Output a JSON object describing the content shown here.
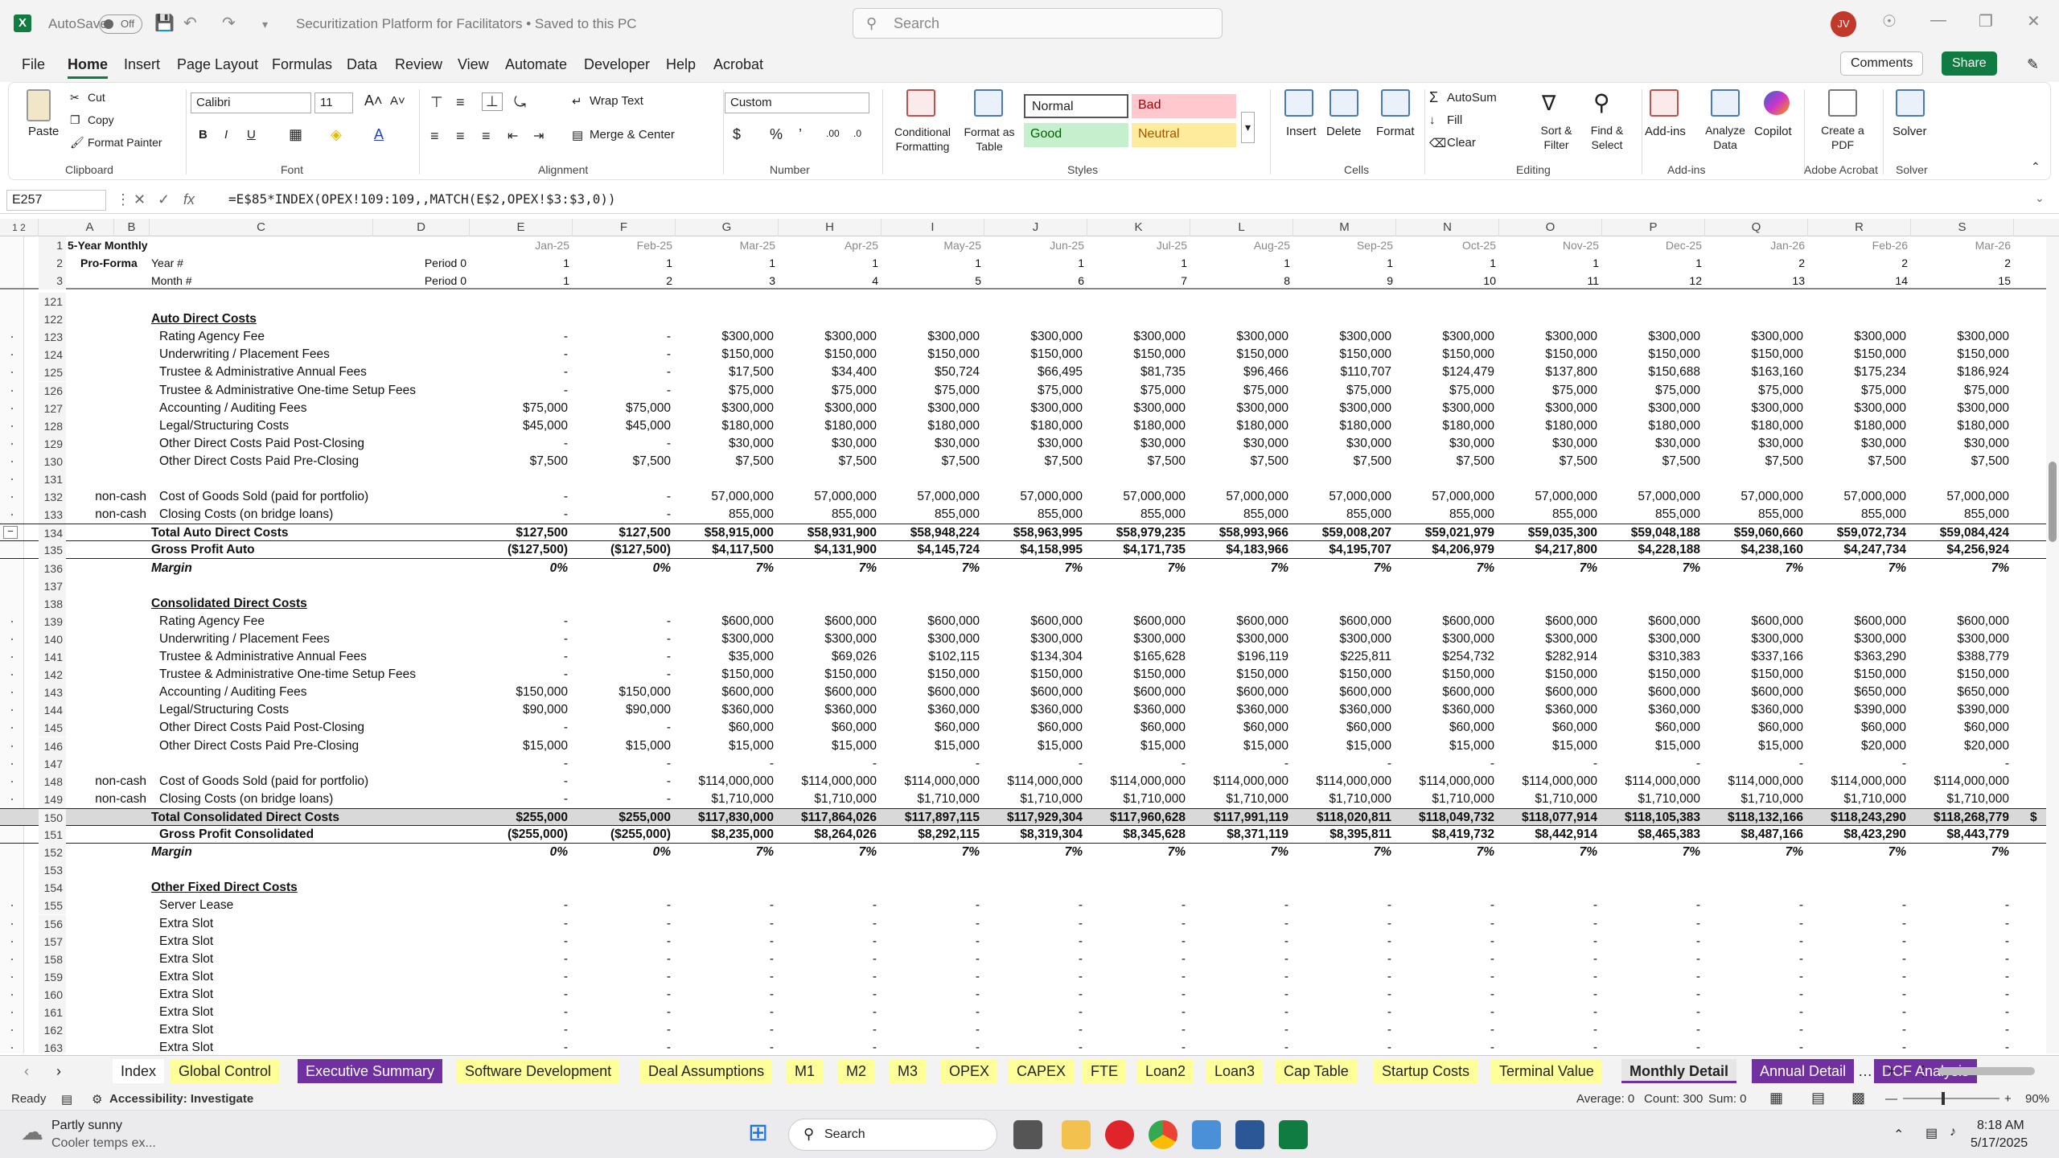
{
  "titlebar": {
    "autosave": "AutoSave",
    "toggle": "Off",
    "title": "Securitization Platform for Facilitators • Saved to this PC",
    "search": "Search",
    "avatar": "JV"
  },
  "menu": [
    "File",
    "Home",
    "Insert",
    "Page Layout",
    "Formulas",
    "Data",
    "Review",
    "View",
    "Automate",
    "Developer",
    "Help",
    "Acrobat"
  ],
  "menu_right": {
    "comments": "Comments",
    "share": "Share"
  },
  "ribbon": {
    "clipboard": {
      "paste": "Paste",
      "cut": "Cut",
      "copy": "Copy",
      "format_painter": "Format Painter",
      "label": "Clipboard"
    },
    "font": {
      "name": "Calibri",
      "size": "11",
      "label": "Font"
    },
    "alignment": {
      "wrap": "Wrap Text",
      "merge": "Merge & Center",
      "label": "Alignment"
    },
    "number": {
      "format": "Custom",
      "label": "Number"
    },
    "styles": {
      "conditional": "Conditional Formatting",
      "format_table": "Format as Table",
      "normal": "Normal",
      "bad": "Bad",
      "good": "Good",
      "neutral": "Neutral",
      "label": "Styles"
    },
    "cells": {
      "insert": "Insert",
      "delete": "Delete",
      "format": "Format",
      "label": "Cells"
    },
    "editing": {
      "autosum": "AutoSum",
      "fill": "Fill",
      "clear": "Clear",
      "sort": "Sort & Filter",
      "find": "Find & Select",
      "label": "Editing"
    },
    "addins": {
      "addins": "Add-ins",
      "analyze": "Analyze Data",
      "copilot": "Copilot",
      "label": "Add-ins"
    },
    "acrobat": {
      "create": "Create a PDF",
      "label": "Adobe Acrobat"
    },
    "solver": {
      "solver": "Solver",
      "label": "Solver"
    }
  },
  "formula_bar": {
    "cell_ref": "E257",
    "formula": "=E$85*INDEX(OPEX!109:109,,MATCH(E$2,OPEX!$3:$3,0))"
  },
  "columns": [
    "A",
    "B",
    "C",
    "D",
    "E",
    "F",
    "G",
    "H",
    "I",
    "J",
    "K",
    "L",
    "M",
    "N",
    "O",
    "P",
    "Q",
    "R",
    "S"
  ],
  "header_rows": {
    "r1": {
      "label": "5-Year Monthly",
      "dates": [
        "Jan-25",
        "Feb-25",
        "Mar-25",
        "Apr-25",
        "May-25",
        "Jun-25",
        "Jul-25",
        "Aug-25",
        "Sep-25",
        "Oct-25",
        "Nov-25",
        "Dec-25",
        "Jan-26",
        "Feb-26",
        "Mar-26"
      ]
    },
    "r2": {
      "label": "Pro-Forma",
      "c": "Year #",
      "d": "Period 0",
      "vals": [
        "1",
        "1",
        "1",
        "1",
        "1",
        "1",
        "1",
        "1",
        "1",
        "1",
        "1",
        "1",
        "2",
        "2",
        "2"
      ]
    },
    "r3": {
      "c": "Month #",
      "d": "Period 0",
      "vals": [
        "1",
        "2",
        "3",
        "4",
        "5",
        "6",
        "7",
        "8",
        "9",
        "10",
        "11",
        "12",
        "13",
        "14",
        "15"
      ]
    }
  },
  "rows": [
    {
      "n": "121"
    },
    {
      "n": "122",
      "hdr": "Auto Direct Costs"
    },
    {
      "n": "123",
      "c": "Rating Agency Fee",
      "v": [
        "-",
        "-",
        "$300,000",
        "$300,000",
        "$300,000",
        "$300,000",
        "$300,000",
        "$300,000",
        "$300,000",
        "$300,000",
        "$300,000",
        "$300,000",
        "$300,000",
        "$300,000",
        "$300,000"
      ]
    },
    {
      "n": "124",
      "c": "Underwriting / Placement Fees",
      "v": [
        "-",
        "-",
        "$150,000",
        "$150,000",
        "$150,000",
        "$150,000",
        "$150,000",
        "$150,000",
        "$150,000",
        "$150,000",
        "$150,000",
        "$150,000",
        "$150,000",
        "$150,000",
        "$150,000"
      ]
    },
    {
      "n": "125",
      "c": "Trustee & Administrative Annual Fees",
      "v": [
        "-",
        "-",
        "$17,500",
        "$34,400",
        "$50,724",
        "$66,495",
        "$81,735",
        "$96,466",
        "$110,707",
        "$124,479",
        "$137,800",
        "$150,688",
        "$163,160",
        "$175,234",
        "$186,924"
      ]
    },
    {
      "n": "126",
      "c": "Trustee & Administrative One-time Setup Fees",
      "v": [
        "-",
        "-",
        "$75,000",
        "$75,000",
        "$75,000",
        "$75,000",
        "$75,000",
        "$75,000",
        "$75,000",
        "$75,000",
        "$75,000",
        "$75,000",
        "$75,000",
        "$75,000",
        "$75,000"
      ]
    },
    {
      "n": "127",
      "c": "Accounting / Auditing Fees",
      "v": [
        "$75,000",
        "$75,000",
        "$300,000",
        "$300,000",
        "$300,000",
        "$300,000",
        "$300,000",
        "$300,000",
        "$300,000",
        "$300,000",
        "$300,000",
        "$300,000",
        "$300,000",
        "$300,000",
        "$300,000"
      ]
    },
    {
      "n": "128",
      "c": "Legal/Structuring Costs",
      "v": [
        "$45,000",
        "$45,000",
        "$180,000",
        "$180,000",
        "$180,000",
        "$180,000",
        "$180,000",
        "$180,000",
        "$180,000",
        "$180,000",
        "$180,000",
        "$180,000",
        "$180,000",
        "$180,000",
        "$180,000"
      ]
    },
    {
      "n": "129",
      "c": "Other Direct Costs Paid Post-Closing",
      "v": [
        "-",
        "-",
        "$30,000",
        "$30,000",
        "$30,000",
        "$30,000",
        "$30,000",
        "$30,000",
        "$30,000",
        "$30,000",
        "$30,000",
        "$30,000",
        "$30,000",
        "$30,000",
        "$30,000"
      ]
    },
    {
      "n": "130",
      "c": "Other Direct Costs Paid Pre-Closing",
      "v": [
        "$7,500",
        "$7,500",
        "$7,500",
        "$7,500",
        "$7,500",
        "$7,500",
        "$7,500",
        "$7,500",
        "$7,500",
        "$7,500",
        "$7,500",
        "$7,500",
        "$7,500",
        "$7,500",
        "$7,500"
      ]
    },
    {
      "n": "131"
    },
    {
      "n": "132",
      "nc": "non-cash",
      "c": "Cost of Goods Sold (paid for portfolio)",
      "v": [
        "-",
        "-",
        "57,000,000",
        "57,000,000",
        "57,000,000",
        "57,000,000",
        "57,000,000",
        "57,000,000",
        "57,000,000",
        "57,000,000",
        "57,000,000",
        "57,000,000",
        "57,000,000",
        "57,000,000",
        "57,000,000"
      ]
    },
    {
      "n": "133",
      "nc": "non-cash",
      "c": "Closing Costs (on bridge loans)",
      "v": [
        "-",
        "-",
        "855,000",
        "855,000",
        "855,000",
        "855,000",
        "855,000",
        "855,000",
        "855,000",
        "855,000",
        "855,000",
        "855,000",
        "855,000",
        "855,000",
        "855,000"
      ]
    },
    {
      "n": "134",
      "bold": true,
      "total": true,
      "cb": "Total Auto Direct Costs",
      "v": [
        "$127,500",
        "$127,500",
        "$58,915,000",
        "$58,931,900",
        "$58,948,224",
        "$58,963,995",
        "$58,979,235",
        "$58,993,966",
        "$59,008,207",
        "$59,021,979",
        "$59,035,300",
        "$59,048,188",
        "$59,060,660",
        "$59,072,734",
        "$59,084,424"
      ]
    },
    {
      "n": "135",
      "bold": true,
      "gp": true,
      "cb": "Gross Profit Auto",
      "v": [
        "($127,500)",
        "($127,500)",
        "$4,117,500",
        "$4,131,900",
        "$4,145,724",
        "$4,158,995",
        "$4,171,735",
        "$4,183,966",
        "$4,195,707",
        "$4,206,979",
        "$4,217,800",
        "$4,228,188",
        "$4,238,160",
        "$4,247,734",
        "$4,256,924"
      ]
    },
    {
      "n": "136",
      "ital": true,
      "ci": "Margin",
      "v": [
        "0%",
        "0%",
        "7%",
        "7%",
        "7%",
        "7%",
        "7%",
        "7%",
        "7%",
        "7%",
        "7%",
        "7%",
        "7%",
        "7%",
        "7%"
      ]
    },
    {
      "n": "137"
    },
    {
      "n": "138",
      "hdr": "Consolidated Direct Costs"
    },
    {
      "n": "139",
      "c": "Rating Agency Fee",
      "v": [
        "-",
        "-",
        "$600,000",
        "$600,000",
        "$600,000",
        "$600,000",
        "$600,000",
        "$600,000",
        "$600,000",
        "$600,000",
        "$600,000",
        "$600,000",
        "$600,000",
        "$600,000",
        "$600,000"
      ]
    },
    {
      "n": "140",
      "c": "Underwriting / Placement Fees",
      "v": [
        "-",
        "-",
        "$300,000",
        "$300,000",
        "$300,000",
        "$300,000",
        "$300,000",
        "$300,000",
        "$300,000",
        "$300,000",
        "$300,000",
        "$300,000",
        "$300,000",
        "$300,000",
        "$300,000"
      ]
    },
    {
      "n": "141",
      "c": "Trustee & Administrative Annual Fees",
      "v": [
        "-",
        "-",
        "$35,000",
        "$69,026",
        "$102,115",
        "$134,304",
        "$165,628",
        "$196,119",
        "$225,811",
        "$254,732",
        "$282,914",
        "$310,383",
        "$337,166",
        "$363,290",
        "$388,779"
      ]
    },
    {
      "n": "142",
      "c": "Trustee & Administrative One-time Setup Fees",
      "v": [
        "-",
        "-",
        "$150,000",
        "$150,000",
        "$150,000",
        "$150,000",
        "$150,000",
        "$150,000",
        "$150,000",
        "$150,000",
        "$150,000",
        "$150,000",
        "$150,000",
        "$150,000",
        "$150,000"
      ]
    },
    {
      "n": "143",
      "c": "Accounting / Auditing Fees",
      "v": [
        "$150,000",
        "$150,000",
        "$600,000",
        "$600,000",
        "$600,000",
        "$600,000",
        "$600,000",
        "$600,000",
        "$600,000",
        "$600,000",
        "$600,000",
        "$600,000",
        "$600,000",
        "$650,000",
        "$650,000"
      ]
    },
    {
      "n": "144",
      "c": "Legal/Structuring Costs",
      "v": [
        "$90,000",
        "$90,000",
        "$360,000",
        "$360,000",
        "$360,000",
        "$360,000",
        "$360,000",
        "$360,000",
        "$360,000",
        "$360,000",
        "$360,000",
        "$360,000",
        "$360,000",
        "$390,000",
        "$390,000"
      ]
    },
    {
      "n": "145",
      "c": "Other Direct Costs Paid Post-Closing",
      "v": [
        "-",
        "-",
        "$60,000",
        "$60,000",
        "$60,000",
        "$60,000",
        "$60,000",
        "$60,000",
        "$60,000",
        "$60,000",
        "$60,000",
        "$60,000",
        "$60,000",
        "$60,000",
        "$60,000"
      ]
    },
    {
      "n": "146",
      "c": "Other Direct Costs Paid Pre-Closing",
      "v": [
        "$15,000",
        "$15,000",
        "$15,000",
        "$15,000",
        "$15,000",
        "$15,000",
        "$15,000",
        "$15,000",
        "$15,000",
        "$15,000",
        "$15,000",
        "$15,000",
        "$15,000",
        "$20,000",
        "$20,000"
      ]
    },
    {
      "n": "147",
      "v": [
        "-",
        "-",
        "-",
        "-",
        "-",
        "-",
        "-",
        "-",
        "-",
        "-",
        "-",
        "-",
        "-",
        "-",
        "-"
      ]
    },
    {
      "n": "148",
      "nc": "non-cash",
      "c": "Cost of Goods Sold (paid for portfolio)",
      "v": [
        "-",
        "-",
        "$114,000,000",
        "$114,000,000",
        "$114,000,000",
        "$114,000,000",
        "$114,000,000",
        "$114,000,000",
        "$114,000,000",
        "$114,000,000",
        "$114,000,000",
        "$114,000,000",
        "$114,000,000",
        "$114,000,000",
        "$114,000,000"
      ]
    },
    {
      "n": "149",
      "nc": "non-cash",
      "c": "Closing Costs (on bridge loans)",
      "v": [
        "-",
        "-",
        "$1,710,000",
        "$1,710,000",
        "$1,710,000",
        "$1,710,000",
        "$1,710,000",
        "$1,710,000",
        "$1,710,000",
        "$1,710,000",
        "$1,710,000",
        "$1,710,000",
        "$1,710,000",
        "$1,710,000",
        "$1,710,000"
      ]
    },
    {
      "n": "150",
      "bold": true,
      "total": true,
      "grey": true,
      "cb": "Total Consolidated Direct Costs",
      "v": [
        "$255,000",
        "$255,000",
        "$117,830,000",
        "$117,864,026",
        "$117,897,115",
        "$117,929,304",
        "$117,960,628",
        "$117,991,119",
        "$118,020,811",
        "$118,049,732",
        "$118,077,914",
        "$118,105,383",
        "$118,132,166",
        "$118,243,290",
        "$118,268,779"
      ],
      "extra": "$"
    },
    {
      "n": "151",
      "bold": true,
      "gp": true,
      "cbi": "Gross Profit Consolidated",
      "v": [
        "($255,000)",
        "($255,000)",
        "$8,235,000",
        "$8,264,026",
        "$8,292,115",
        "$8,319,304",
        "$8,345,628",
        "$8,371,119",
        "$8,395,811",
        "$8,419,732",
        "$8,442,914",
        "$8,465,383",
        "$8,487,166",
        "$8,423,290",
        "$8,443,779"
      ]
    },
    {
      "n": "152",
      "ital": true,
      "ci": "Margin",
      "v": [
        "0%",
        "0%",
        "7%",
        "7%",
        "7%",
        "7%",
        "7%",
        "7%",
        "7%",
        "7%",
        "7%",
        "7%",
        "7%",
        "7%",
        "7%"
      ]
    },
    {
      "n": "153"
    },
    {
      "n": "154",
      "hdr": "Other Fixed Direct Costs"
    },
    {
      "n": "155",
      "c": "Server Lease",
      "v": [
        "-",
        "-",
        "-",
        "-",
        "-",
        "-",
        "-",
        "-",
        "-",
        "-",
        "-",
        "-",
        "-",
        "-",
        "-"
      ]
    },
    {
      "n": "156",
      "c": "Extra Slot",
      "v": [
        "-",
        "-",
        "-",
        "-",
        "-",
        "-",
        "-",
        "-",
        "-",
        "-",
        "-",
        "-",
        "-",
        "-",
        "-"
      ]
    },
    {
      "n": "157",
      "c": "Extra Slot",
      "v": [
        "-",
        "-",
        "-",
        "-",
        "-",
        "-",
        "-",
        "-",
        "-",
        "-",
        "-",
        "-",
        "-",
        "-",
        "-"
      ]
    },
    {
      "n": "158",
      "c": "Extra Slot",
      "v": [
        "-",
        "-",
        "-",
        "-",
        "-",
        "-",
        "-",
        "-",
        "-",
        "-",
        "-",
        "-",
        "-",
        "-",
        "-"
      ]
    },
    {
      "n": "159",
      "c": "Extra Slot",
      "v": [
        "-",
        "-",
        "-",
        "-",
        "-",
        "-",
        "-",
        "-",
        "-",
        "-",
        "-",
        "-",
        "-",
        "-",
        "-"
      ]
    },
    {
      "n": "160",
      "c": "Extra Slot",
      "v": [
        "-",
        "-",
        "-",
        "-",
        "-",
        "-",
        "-",
        "-",
        "-",
        "-",
        "-",
        "-",
        "-",
        "-",
        "-"
      ]
    },
    {
      "n": "161",
      "c": "Extra Slot",
      "v": [
        "-",
        "-",
        "-",
        "-",
        "-",
        "-",
        "-",
        "-",
        "-",
        "-",
        "-",
        "-",
        "-",
        "-",
        "-"
      ]
    },
    {
      "n": "162",
      "c": "Extra Slot",
      "v": [
        "-",
        "-",
        "-",
        "-",
        "-",
        "-",
        "-",
        "-",
        "-",
        "-",
        "-",
        "-",
        "-",
        "-",
        "-"
      ]
    },
    {
      "n": "163",
      "c": "Extra Slot",
      "v": [
        "-",
        "-",
        "-",
        "-",
        "-",
        "-",
        "-",
        "-",
        "-",
        "-",
        "-",
        "-",
        "-",
        "-",
        "-"
      ]
    }
  ],
  "sheet_tabs": [
    {
      "label": "Index",
      "style": "idx"
    },
    {
      "label": "Global Control",
      "style": "y"
    },
    {
      "label": "Executive Summary",
      "style": "p"
    },
    {
      "label": "Software Development",
      "style": "y"
    },
    {
      "label": "Deal Assumptions",
      "style": "y"
    },
    {
      "label": "M1",
      "style": "y"
    },
    {
      "label": "M2",
      "style": "y"
    },
    {
      "label": "M3",
      "style": "y"
    },
    {
      "label": "OPEX",
      "style": "y"
    },
    {
      "label": "CAPEX",
      "style": "y"
    },
    {
      "label": "FTE",
      "style": "y"
    },
    {
      "label": "Loan2",
      "style": "y"
    },
    {
      "label": "Loan3",
      "style": "y"
    },
    {
      "label": "Cap Table",
      "style": "y"
    },
    {
      "label": "Startup Costs",
      "style": "y"
    },
    {
      "label": "Terminal Value",
      "style": "y"
    },
    {
      "label": "Monthly Detail",
      "style": "act"
    },
    {
      "label": "Annual Detail",
      "style": "p"
    },
    {
      "label": "DCF Analysis",
      "style": "p"
    }
  ],
  "status": {
    "ready": "Ready",
    "accessibility": "Accessibility: Investigate",
    "average": "Average: 0",
    "count": "Count: 300",
    "sum": "Sum: 0",
    "zoom": "90%"
  },
  "taskbar": {
    "weather1": "Partly sunny",
    "weather2": "Cooler temps ex...",
    "search": "Search",
    "time": "8:18 AM",
    "date": "5/17/2025"
  }
}
